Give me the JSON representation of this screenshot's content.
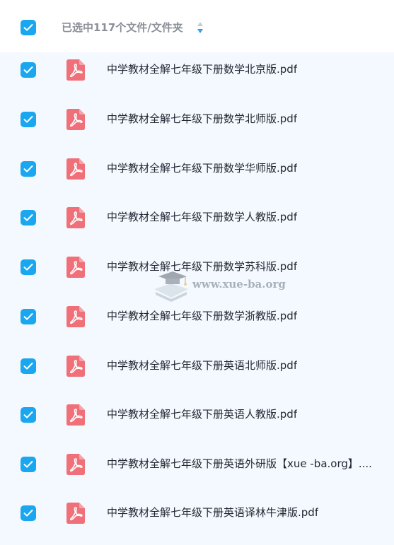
{
  "header": {
    "select_all_checked": true,
    "label": "已选中117个文件/文件夹",
    "sort_icon": "sort-arrows-icon"
  },
  "accent_color": "#1aa7ef",
  "pdf_icon_color": "#f07079",
  "files": [
    {
      "name": "中学教材全解七年级下册数学北京版.pdf",
      "checked": true,
      "icon": "pdf-icon"
    },
    {
      "name": "中学教材全解七年级下册数学北师版.pdf",
      "checked": true,
      "icon": "pdf-icon"
    },
    {
      "name": "中学教材全解七年级下册数学华师版.pdf",
      "checked": true,
      "icon": "pdf-icon"
    },
    {
      "name": "中学教材全解七年级下册数学人教版.pdf",
      "checked": true,
      "icon": "pdf-icon"
    },
    {
      "name": "中学教材全解七年级下册数学苏科版.pdf",
      "checked": true,
      "icon": "pdf-icon"
    },
    {
      "name": "中学教材全解七年级下册数学浙教版.pdf",
      "checked": true,
      "icon": "pdf-icon"
    },
    {
      "name": "中学教材全解七年级下册英语北师版.pdf",
      "checked": true,
      "icon": "pdf-icon"
    },
    {
      "name": "中学教材全解七年级下册英语人教版.pdf",
      "checked": true,
      "icon": "pdf-icon"
    },
    {
      "name": "中学教材全解七年级下册英语外研版【xue -ba.org】....",
      "checked": true,
      "icon": "pdf-icon"
    },
    {
      "name": "中学教材全解七年级下册英语译林牛津版.pdf",
      "checked": true,
      "icon": "pdf-icon"
    }
  ],
  "watermark": {
    "text": "www.xue-ba.org"
  }
}
